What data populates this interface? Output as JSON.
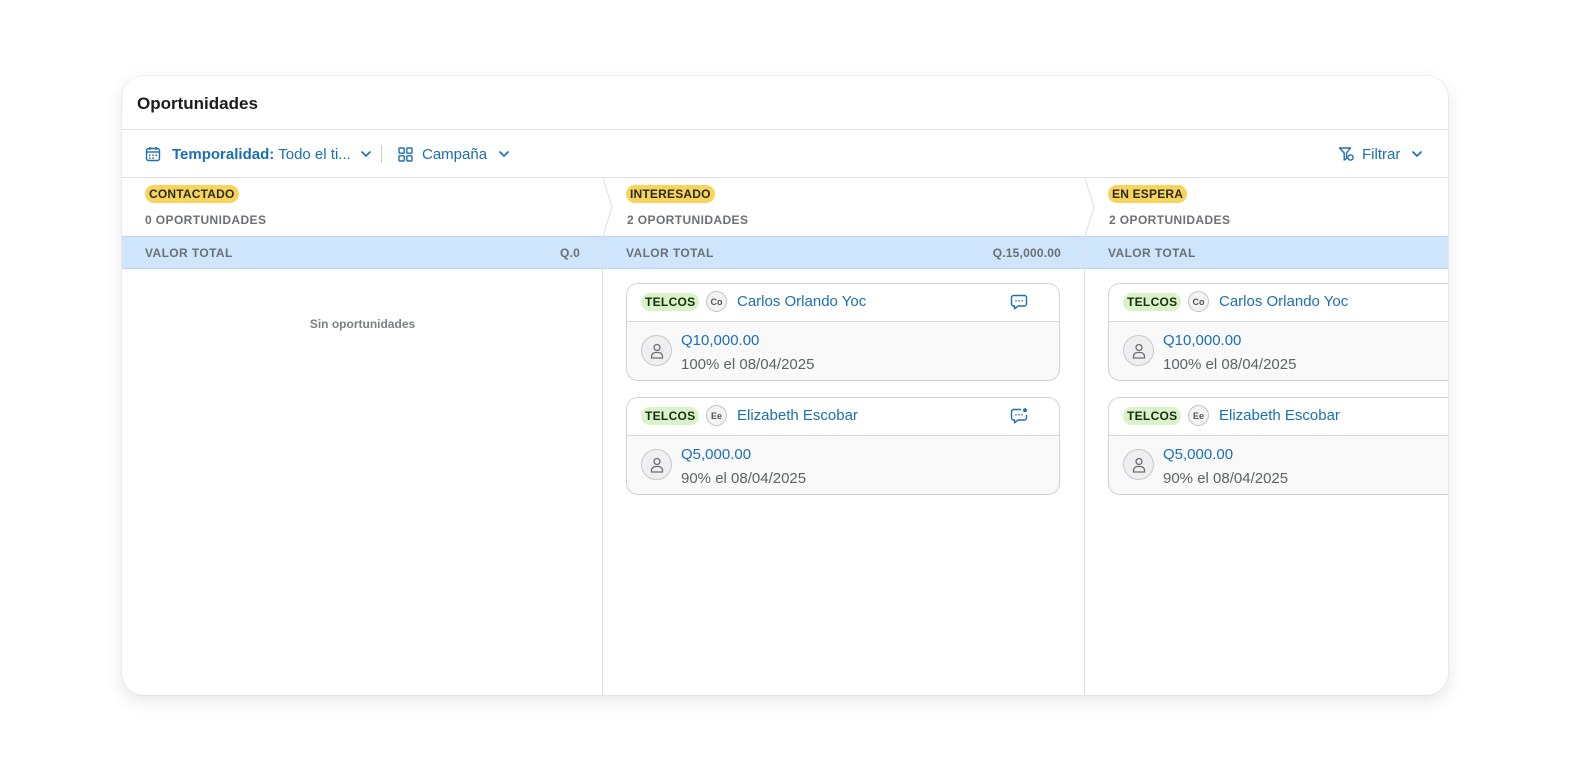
{
  "panel": {
    "title": "Oportunidades"
  },
  "toolbar": {
    "temporalidad_label": "Temporalidad:",
    "temporalidad_value": "Todo el ti...",
    "campana_label": "Campaña",
    "filtrar_label": "Filtrar"
  },
  "columns": [
    {
      "stage": "CONTACTADO",
      "count": "0 OPORTUNIDADES",
      "total_label": "VALOR TOTAL",
      "total_value": "Q.0",
      "empty_message": "Sin oportunidades",
      "cards": []
    },
    {
      "stage": "INTERESADO",
      "count": "2 OPORTUNIDADES",
      "total_label": "VALOR TOTAL",
      "total_value": "Q.15,000.00",
      "cards": [
        {
          "tag": "TELCOS",
          "initials": "Co",
          "name": "Carlos Orlando Yoc",
          "amount": "Q10,000.00",
          "probability": "100% el 08/04/2025",
          "chat_icon": "chat-bubble-icon"
        },
        {
          "tag": "TELCOS",
          "initials": "Ee",
          "name": "Elizabeth Escobar",
          "amount": "Q5,000.00",
          "probability": "90% el 08/04/2025",
          "chat_icon": "chat-bubble-unread-icon"
        }
      ]
    },
    {
      "stage": "EN ESPERA",
      "count": "2 OPORTUNIDADES",
      "total_label": "VALOR TOTAL",
      "total_value": "",
      "cards": [
        {
          "tag": "TELCOS",
          "initials": "Co",
          "name": "Carlos Orlando Yoc",
          "amount": "Q10,000.00",
          "probability": "100% el 08/04/2025"
        },
        {
          "tag": "TELCOS",
          "initials": "Ee",
          "name": "Elizabeth Escobar",
          "amount": "Q5,000.00",
          "probability": "90% el 08/04/2025"
        }
      ]
    }
  ],
  "colors": {
    "accent": "#1b6fb3",
    "stage_badge": "#f8d55a",
    "tag_bg": "#d9f3c9",
    "total_bar": "#cfe5fb"
  }
}
